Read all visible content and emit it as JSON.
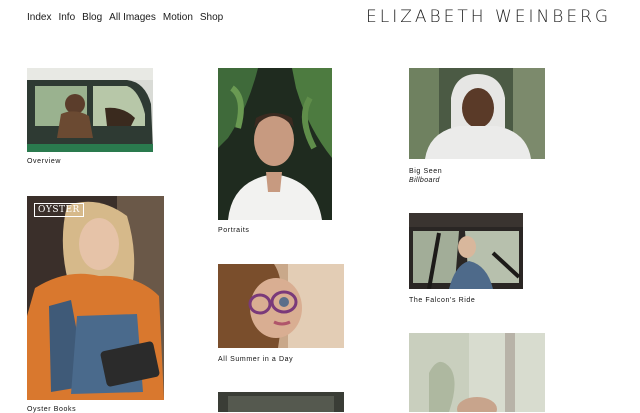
{
  "nav": {
    "index": "Index",
    "info": "Info",
    "blog": "Blog",
    "all_images": "All Images",
    "motion": "Motion",
    "shop": "Shop"
  },
  "brand": "ELIZABETH WEINBERG",
  "tiles": {
    "overview": {
      "caption": "Overview"
    },
    "portraits": {
      "caption": "Portraits"
    },
    "big_seen": {
      "caption": "Big Seen",
      "subcaption": "Billboard"
    },
    "oyster": {
      "badge": "OYSTER",
      "caption": "Oyster Books"
    },
    "summer": {
      "caption": "All Summer in a Day"
    },
    "falcon": {
      "caption": "The Falcon's Ride"
    }
  }
}
